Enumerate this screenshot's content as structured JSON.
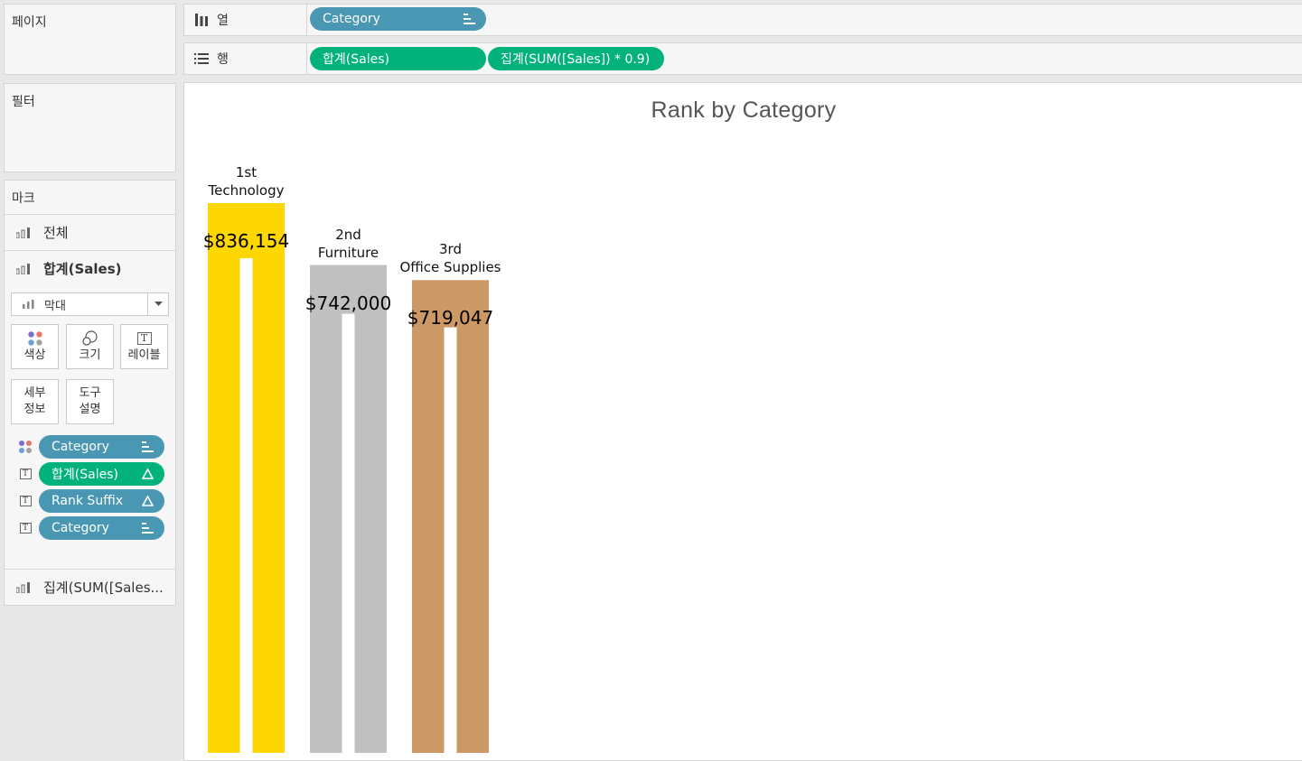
{
  "panels": {
    "pages_title": "페이지",
    "filters_title": "필터",
    "marks_title": "마크"
  },
  "columns_shelf": {
    "label": "열",
    "pills": [
      {
        "text": "Category",
        "color": "#4a97b4",
        "icon": "sort-icon"
      }
    ]
  },
  "rows_shelf": {
    "label": "행",
    "pills": [
      {
        "text": "합계(Sales)",
        "color": "#02b27a"
      },
      {
        "text": "집계(SUM([Sales]) * 0.9)",
        "color": "#02b27a"
      }
    ]
  },
  "marks": {
    "all": "전체",
    "sales": "합계(Sales)",
    "mark_type": "막대",
    "buttons": {
      "color": "색상",
      "size": "크기",
      "label": "레이블",
      "detail_1": "세부",
      "detail_2": "정보",
      "tooltip_1": "도구",
      "tooltip_2": "설명"
    },
    "encodings": [
      {
        "icon": "color-dots-icon",
        "text": "Category",
        "color": "#4a97b4",
        "suffix": "sort-icon"
      },
      {
        "icon": "label-text-icon",
        "text": "합계(Sales)",
        "color": "#02b27a",
        "suffix": "delta-icon"
      },
      {
        "icon": "label-text-icon",
        "text": "Rank Suffix",
        "color": "#4a97b4",
        "suffix": "delta-icon"
      },
      {
        "icon": "label-text-icon",
        "text": "Category",
        "color": "#4a97b4",
        "suffix": "sort-icon"
      }
    ],
    "agg_card": "집계(SUM([Sales..."
  },
  "chart_data": {
    "type": "bar",
    "title": "Rank by Category",
    "categories": [
      "Technology",
      "Furniture",
      "Office Supplies"
    ],
    "ranks": [
      "1st",
      "2nd",
      "3rd"
    ],
    "value_labels": [
      "$836,154",
      "$742,000",
      "$719,047"
    ],
    "series": [
      {
        "name": "합계(Sales)",
        "values": [
          836154,
          742000,
          719047
        ]
      },
      {
        "name": "집계(SUM([Sales]) * 0.9)",
        "values": [
          752539,
          667800,
          647142
        ]
      }
    ],
    "colors": [
      "#fed700",
      "#c0c0c0",
      "#cc9966"
    ],
    "inner_color": "#ffffff",
    "ylim": [
      0,
      900000
    ],
    "grid": false
  }
}
